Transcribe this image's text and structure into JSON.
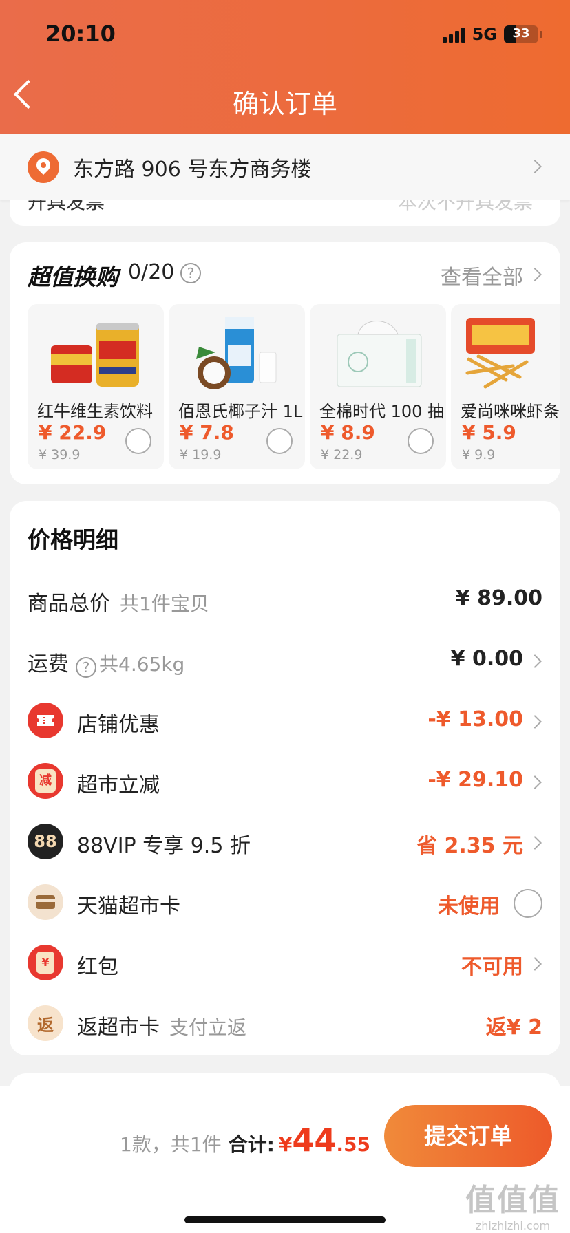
{
  "status_bar": {
    "time": "20:10",
    "network": "5G",
    "battery": "33"
  },
  "header": {
    "title": "确认订单"
  },
  "address": {
    "text": "东方路 906 号东方商务楼"
  },
  "hidden_row": {
    "left": "开具发票",
    "right": "本次不开具发票"
  },
  "trade_up": {
    "title": "超值换购",
    "count": "0/20",
    "view_all": "查看全部",
    "products": [
      {
        "name": "红牛维生素饮料",
        "price": "¥ 22.9",
        "original": "¥ 39.9"
      },
      {
        "name": "佰恩氏椰子汁 1L",
        "price": "¥ 7.8",
        "original": "¥ 19.9"
      },
      {
        "name": "全棉时代 100 抽",
        "price": "¥ 8.9",
        "original": "¥ 22.9"
      },
      {
        "name": "爱尚咪咪虾条",
        "price": "¥ 5.9",
        "original": "¥ 9.9"
      }
    ]
  },
  "price_detail": {
    "title": "价格明细",
    "rows": [
      {
        "label": "商品总价",
        "sub": "共1件宝贝",
        "value": "¥ 89.00"
      },
      {
        "label": "运费",
        "sub": "共4.65kg",
        "value": "¥ 0.00"
      },
      {
        "label": "店铺优惠",
        "value": "-¥ 13.00",
        "icon": "ticket-icon",
        "icon_color": "#e8382f"
      },
      {
        "label": "超市立减",
        "value": "-¥ 29.10",
        "icon": "discount-icon",
        "icon_char": "减",
        "icon_color": "#e8382f"
      },
      {
        "label": "88VIP 专享 9.5 折",
        "value": "省 2.35 元",
        "icon": "vip-icon",
        "icon_char": "88",
        "icon_color": "#222222"
      },
      {
        "label": "天猫超市卡",
        "value": "未使用",
        "icon": "card-icon",
        "icon_color": "#f3e2cf"
      },
      {
        "label": "红包",
        "value": "不可用",
        "icon": "red-packet-icon",
        "icon_char": "¥",
        "icon_color": "#e8382f"
      },
      {
        "label": "返超市卡",
        "sub": "支付立返",
        "value": "返¥ 2",
        "icon": "rebate-icon",
        "icon_char": "返",
        "icon_color": "#f7e3cc"
      }
    ]
  },
  "footer": {
    "count_text": "1款，共1件",
    "total_label": "合计:",
    "currency": "¥",
    "total_int": "44",
    "total_dec": ".55",
    "submit_label": "提交订单",
    "watermark": "值值值",
    "watermark_sub": "zhizhizhi.com"
  },
  "colors": {
    "accent": "#ee5a2c",
    "header": "#ec6b3c",
    "price_red": "#ee3b1c"
  }
}
